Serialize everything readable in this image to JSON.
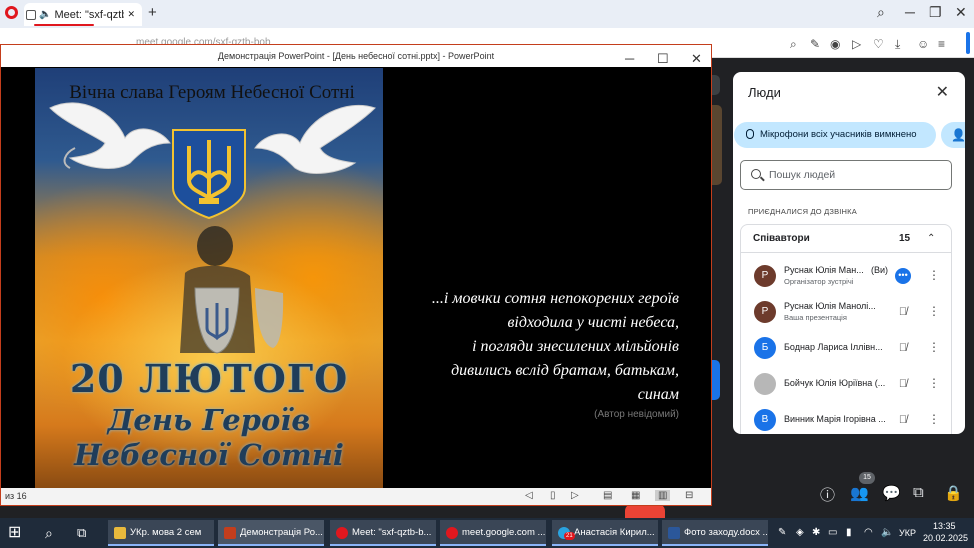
{
  "browser": {
    "tab_title": "Meet: \"sxf-qztb-bo",
    "new_tab": "+",
    "address": "meet.google.com/sxf-qztb-bob",
    "search_icon": "search-icon",
    "minimize": "─",
    "maximize": "❐",
    "close": "✕"
  },
  "ppt": {
    "window_title": "Демонстрація PowerPoint - [День небесної сотні.pptx] - PowerPoint",
    "minimize": "─",
    "maximize": "☐",
    "close": "✕",
    "slide_counter": "из 16",
    "poster_title": "Вічна слава Героям Небесної Сотні",
    "poster_date": "20 ЛЮТОГО",
    "poster_day_line1": "День Героїв",
    "poster_day_line2": "Небесної Сотні",
    "quote_lines": [
      "...і мовчки сотня непокорених героїв",
      "відходила у чисті небеса,",
      "і погляди знесилених мільйонів",
      "дивились вслід братам, батькам,",
      "синам"
    ],
    "quote_author": "(Автор невідомий)"
  },
  "people_panel": {
    "title": "Люди",
    "close": "✕",
    "mic_chip": "Мікрофони всіх учасників вимкнено",
    "add_chip": "👤",
    "search_placeholder": "Пошук людей",
    "joined_label": "ПРИЄДНАЛИСЯ ДО ДЗВІНКА",
    "group_name": "Співавтори",
    "group_count": "15",
    "group_chevron": "⌃",
    "people": [
      {
        "initial": "Р",
        "name": "Руснак Юлія Ман...",
        "sub": "Організатор зустрічі",
        "you": "(Ви)",
        "color": "#6d3b2c"
      },
      {
        "initial": "Р",
        "name": "Руснак Юлія Манолі...",
        "sub": "Ваша презентація",
        "you": "",
        "color": "#6d3b2c"
      },
      {
        "initial": "Б",
        "name": "Боднар Лариса Іллівн...",
        "sub": "",
        "you": "",
        "color": "#1a73e8"
      },
      {
        "initial": "",
        "name": "Бойчук Юлія Юріївна (...",
        "sub": "",
        "you": "",
        "color": "#b7b7b7"
      },
      {
        "initial": "В",
        "name": "Винник Марія Ігорівна ...",
        "sub": "",
        "you": "",
        "color": "#1a73e8"
      }
    ]
  },
  "meet_controls": {
    "people_count": "15"
  },
  "taskbar": {
    "apps": [
      {
        "label": "УКр. мова 2 сем",
        "color": "#e8b93c"
      },
      {
        "label": "Демонстрація Ро...",
        "color": "#c43e1c"
      },
      {
        "label": "Meet: \"sxf-qztb-b...",
        "color": "#e0171e"
      },
      {
        "label": "meet.google.com ...",
        "color": "#e0171e"
      },
      {
        "label": "Анастасія Кирил...",
        "color": "#2aa3e0"
      },
      {
        "label": "Фото заходу.docx ...",
        "color": "#2b579a"
      }
    ],
    "telegram_badge": "21",
    "lang": "УКР",
    "time": "13:35",
    "date": "20.02.2025"
  }
}
